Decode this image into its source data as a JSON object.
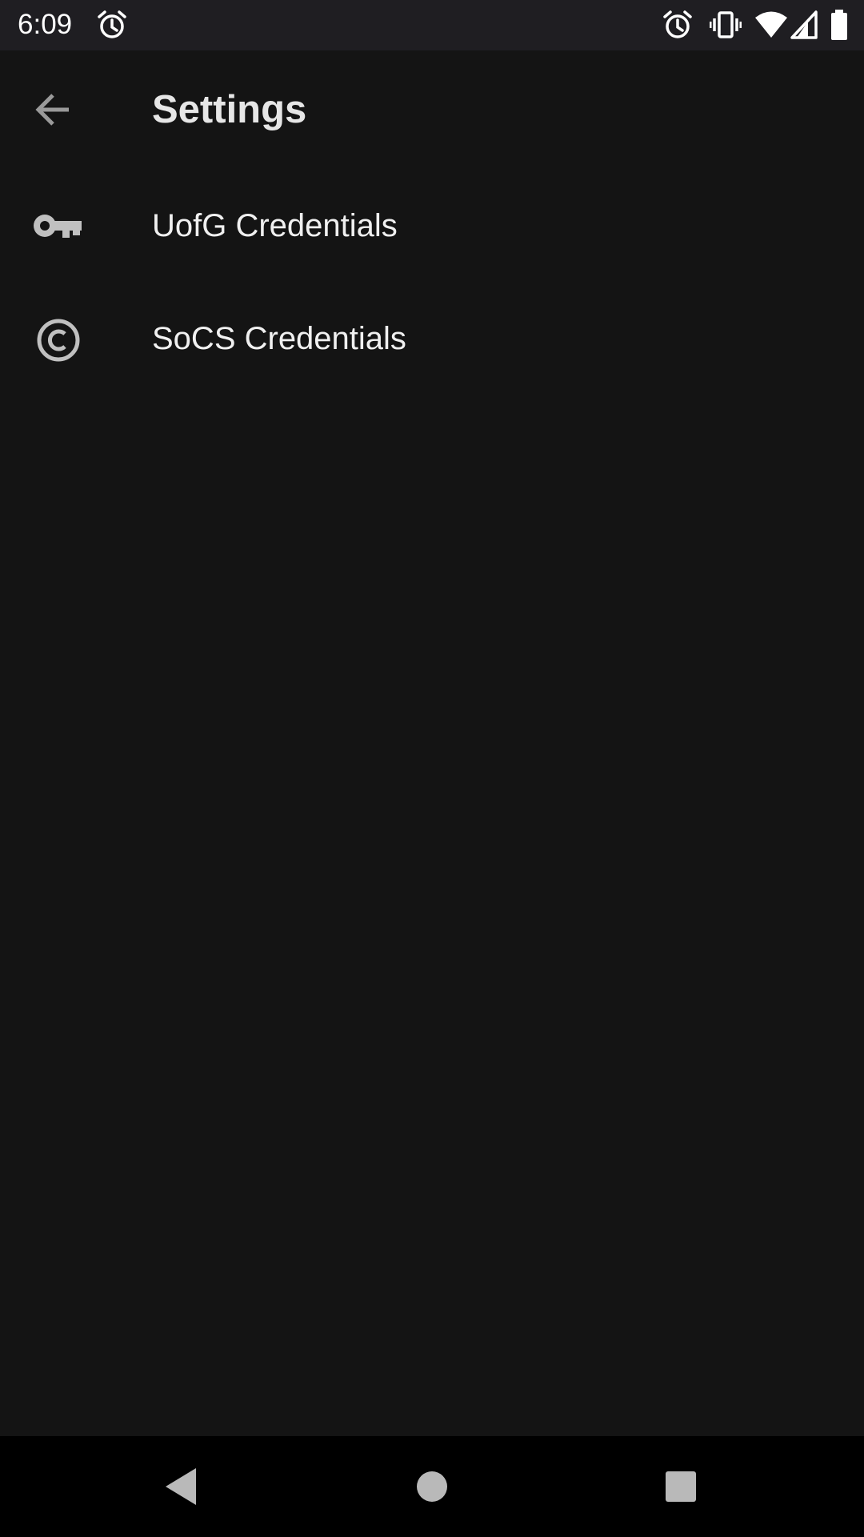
{
  "status_bar": {
    "time": "6:09",
    "icons": [
      "alarm-icon",
      "alarm-icon",
      "vibrate-icon",
      "wifi-icon",
      "cell-signal-icon",
      "battery-icon"
    ]
  },
  "app_bar": {
    "title": "Settings",
    "back_icon": "arrow-back-icon"
  },
  "settings": {
    "items": [
      {
        "label": "UofG Credentials",
        "icon": "key-icon"
      },
      {
        "label": "SoCS Credentials",
        "icon": "copyright-icon"
      }
    ]
  },
  "nav_bar": {
    "buttons": [
      "back-triangle-icon",
      "home-circle-icon",
      "recents-square-icon"
    ]
  },
  "colors": {
    "background": "#141414",
    "status_bar": "#1f1e22",
    "nav_bar": "#000000",
    "text_primary": "#f0f0f0",
    "icon_tint": "#b8b8b8"
  }
}
